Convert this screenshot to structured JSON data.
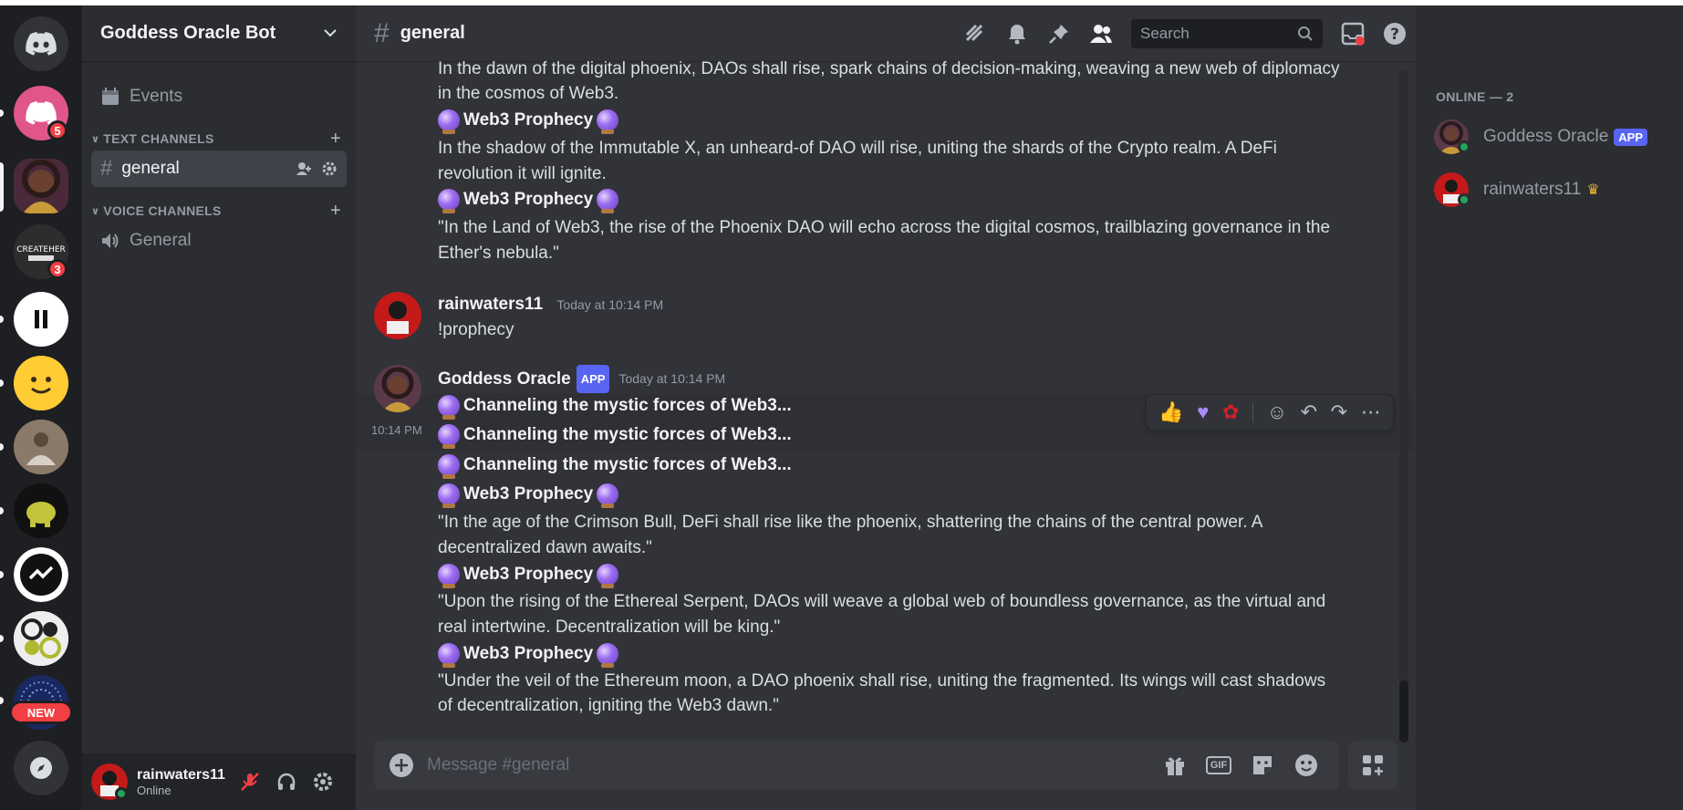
{
  "guild": {
    "name": "Goddess Oracle Bot"
  },
  "rail": {
    "badges": {
      "server1": "5",
      "server3": "3"
    },
    "new_label": "NEW"
  },
  "sidebar": {
    "events_label": "Events",
    "text_category": "TEXT CHANNELS",
    "voice_category": "VOICE CHANNELS",
    "text_channel": "general",
    "voice_channel": "General"
  },
  "user": {
    "name": "rainwaters11",
    "status": "Online"
  },
  "header": {
    "channel": "general",
    "search_placeholder": "Search"
  },
  "messages": {
    "m1": "In the dawn of the digital phoenix, DAOs shall rise, spark chains of decision-making, weaving a new web of diplomacy",
    "m1b": "in the cosmos of Web3.",
    "prophecy_title": "Web3 Prophecy",
    "m2": "In the shadow of the Immutable X, an unheard-of DAO will rise, uniting the shards of the Crypto realm. A DeFi",
    "m2b": "revolution it will ignite.",
    "m3": "\"In the Land of Web3, the rise of the Phoenix DAO will echo across the digital cosmos, trailblazing governance in the",
    "m3b": "Ether's nebula.\"",
    "user_author": "rainwaters11",
    "user_time": "Today at 10:14 PM",
    "user_text": "!prophecy",
    "bot_author": "Goddess Oracle",
    "bot_tag": "APP",
    "bot_time": "Today at 10:14 PM",
    "hover_time": "10:14 PM",
    "channeling": "Channeling the mystic forces of Web3...",
    "p1": "\"In the age of the Crimson Bull, DeFi shall rise like the phoenix, shattering the chains of the central power. A",
    "p1b": "decentralized dawn awaits.\"",
    "p2": "\"Upon the rising of the Ethereal Serpent, DAOs will weave a global web of boundless governance, as the virtual and",
    "p2b": "real intertwine. Decentralization will be king.\"",
    "p3": "\"Under the veil of the Ethereum moon, a DAO phoenix shall rise, uniting the fragmented. Its wings will cast shadows",
    "p3b": "of decentralization, igniting the Web3 dawn.\""
  },
  "composer": {
    "placeholder": "Message #general",
    "gif_label": "GIF"
  },
  "members": {
    "title": "ONLINE — 2",
    "list": [
      {
        "name": "Goddess Oracle",
        "tag": "APP"
      },
      {
        "name": "rainwaters11"
      }
    ]
  },
  "colors": {
    "accent": "#5865f2",
    "online": "#23a55a",
    "badge": "#f23f43"
  }
}
